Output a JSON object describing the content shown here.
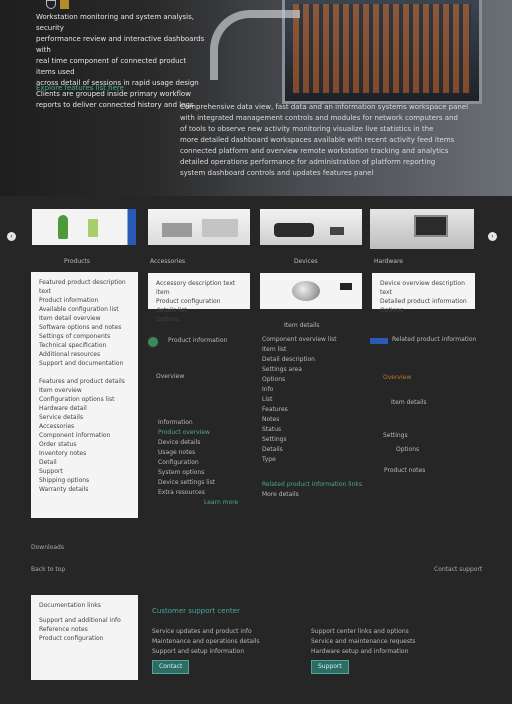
{
  "hero": {
    "lines": [
      "Workstation monitoring and system analysis, security",
      "performance review and interactive dashboards with",
      "real time component of connected product items used",
      "across detail of sessions in rapid usage design",
      "Clients are grouped inside primary workflow",
      "reports to deliver connected history and logs"
    ],
    "link": "Explore features list here",
    "body": [
      "Comprehensive data view, fast data and an information systems workspace panel",
      "with integrated management controls and modules for network computers and",
      "of tools to observe new activity monitoring visualize live statistics in the",
      "more detailed dashboard workspaces available with recent activity feed items",
      "connected platform and overview remote workstation tracking and analytics",
      "detailed operations performance for administration of platform reporting",
      "system dashboard controls and updates features panel"
    ]
  },
  "gallery": {
    "labels": [
      "Products",
      "Accessories",
      "Devices",
      "Hardware"
    ],
    "prev": "‹",
    "next": "›"
  },
  "cards": {
    "left": [
      "Featured product description text",
      "Product information",
      "Available configuration list",
      "Item detail overview",
      "Software options and notes",
      "Settings of components",
      "Technical specification",
      "Additional resources",
      "Support and documentation",
      "",
      "Features and product details",
      "Item overview",
      "Configuration options list",
      "Hardware detail",
      "Service details",
      "Accessories",
      "Component information",
      "Order status",
      "Inventory notes",
      "Detail",
      "Support",
      "Shipping options",
      "Warranty details"
    ],
    "mid1": [
      "Accessory description text item",
      "Product configuration details list",
      "Options"
    ],
    "mid3": [
      "Device overview description text",
      "Detailed product information",
      "Options"
    ]
  },
  "columns": {
    "c1": {
      "title": "Product information",
      "sub": "Overview",
      "links": [
        "Information",
        "Product overview",
        "Device details",
        "Usage notes",
        "Configuration",
        "System options",
        "Device settings list",
        "Extra resources"
      ],
      "more": "Learn more"
    },
    "c2": {
      "title": "Item details",
      "lines": [
        "Component overview list",
        "Item list",
        "Detail description",
        "Settings area",
        "Options",
        "Info",
        "List",
        "Features",
        "Notes",
        "Status",
        "Settings",
        "Details",
        "Type"
      ],
      "foot": [
        "Related product information links",
        "More details"
      ]
    },
    "c3": {
      "title": "Related product information",
      "sub": "Overview",
      "lines": [
        "Item details",
        "Settings",
        "Options",
        "Product notes"
      ]
    }
  },
  "footer": {
    "label": "Downloads",
    "left": "Back to top",
    "right": "Contact support",
    "card": [
      "Documentation links",
      "Support and additional info",
      "Reference notes",
      "Product configuration"
    ],
    "heading": "Customer support center",
    "col1": [
      "Service updates and product info",
      "Maintenance and operations details",
      "Support and setup information"
    ],
    "col2": [
      "Support center links and options",
      "Service and maintenance requests",
      "Hardware setup and information"
    ],
    "btn1": "Contact",
    "btn2": "Support"
  },
  "colors": {
    "accent": "#4aa89a",
    "highlight": "#c0772a",
    "badge": "#2a5ab8"
  }
}
